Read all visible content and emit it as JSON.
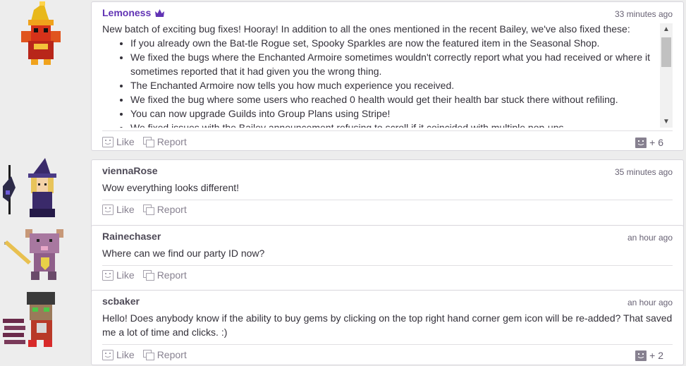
{
  "posts": [
    {
      "username": "Lemoness",
      "timestamp": "33 minutes ago",
      "intro": "New batch of exciting bug fixes! Hooray! In addition to all the ones mentioned in the recent Bailey, we've also fixed these:",
      "bullets": [
        "If you already own the Bat-tle Rogue set, Spooky Sparkles are now the featured item in the Seasonal Shop.",
        "We fixed the bugs where the Enchanted Armoire sometimes wouldn't correctly report what you had received or where it sometimes reported that it had given you the wrong thing.",
        "The Enchanted Armoire now tells you how much experience you received.",
        "We fixed the bug where some users who reached 0 health would get their health bar stuck there without refiling.",
        "You can now upgrade Guilds into Group Plans using Stripe!",
        "We fixed issues with the Bailey announcement refusing to scroll if it coincided with multiple pop-ups."
      ],
      "like_label": "Like",
      "report_label": "Report",
      "like_count": "+ 6"
    },
    {
      "username": "viennaRose",
      "timestamp": "35 minutes ago",
      "text": "Wow everything looks different!",
      "like_label": "Like",
      "report_label": "Report"
    },
    {
      "username": "Rainechaser",
      "timestamp": "an hour ago",
      "text": "Where can we find our party ID now?",
      "like_label": "Like",
      "report_label": "Report"
    },
    {
      "username": "scbaker",
      "timestamp": "an hour ago",
      "text": "Hello! Does anybody know if the ability to buy gems by clicking on the top right hand corner gem icon will be re-added? That saved me a lot of time and clicks. :)",
      "like_label": "Like",
      "report_label": "Report",
      "like_count": "+ 2"
    }
  ],
  "colors": {
    "moderator_name": "#6133b4",
    "username": "#4e4a57",
    "page_bg": "#ededed"
  }
}
